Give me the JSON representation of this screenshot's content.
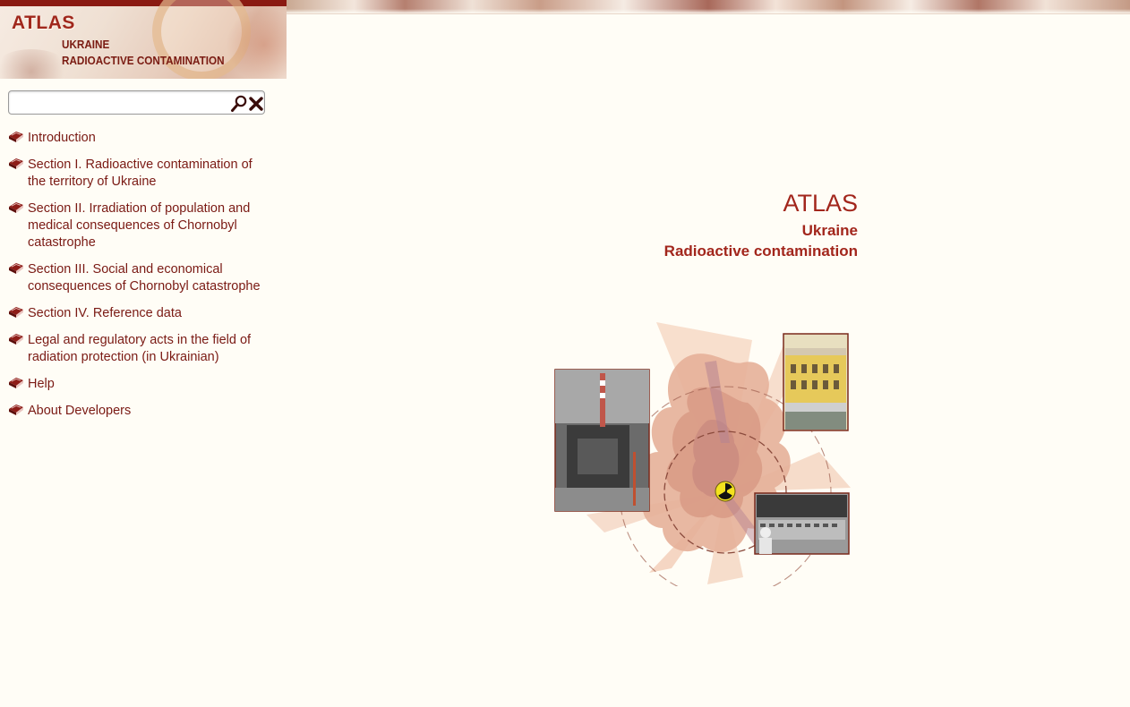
{
  "header": {
    "logo_title": "ATLAS",
    "logo_line1": "UKRAINE",
    "logo_line2": "RADIOACTIVE CONTAMINATION"
  },
  "search": {
    "placeholder": "",
    "value": ""
  },
  "nav": {
    "items": [
      {
        "label": "Introduction"
      },
      {
        "label": "Section I. Radioactive contamination of the territory of Ukraine"
      },
      {
        "label": "Section II. Irradiation of population and medical consequences of Chornobyl catastrophe"
      },
      {
        "label": "Section III. Social and economical consequences of Chornobyl catastrophe"
      },
      {
        "label": "Section IV. Reference data"
      },
      {
        "label": "Legal and regulatory acts in the field of radiation protection (in Ukrainian)"
      },
      {
        "label": "Help"
      },
      {
        "label": "About Developers"
      }
    ]
  },
  "main": {
    "title": "ATLAS",
    "subtitle1": "Ukraine",
    "subtitle2": "Radioactive contamination"
  },
  "icons": {
    "nav_item": "book-icon",
    "search": "search-icon",
    "clear": "close-icon",
    "emblem": "radiation-icon"
  },
  "colors": {
    "accent": "#a2261c",
    "link": "#7a1a14",
    "background": "#fffdf6",
    "logo_bar": "#8a1a12"
  }
}
